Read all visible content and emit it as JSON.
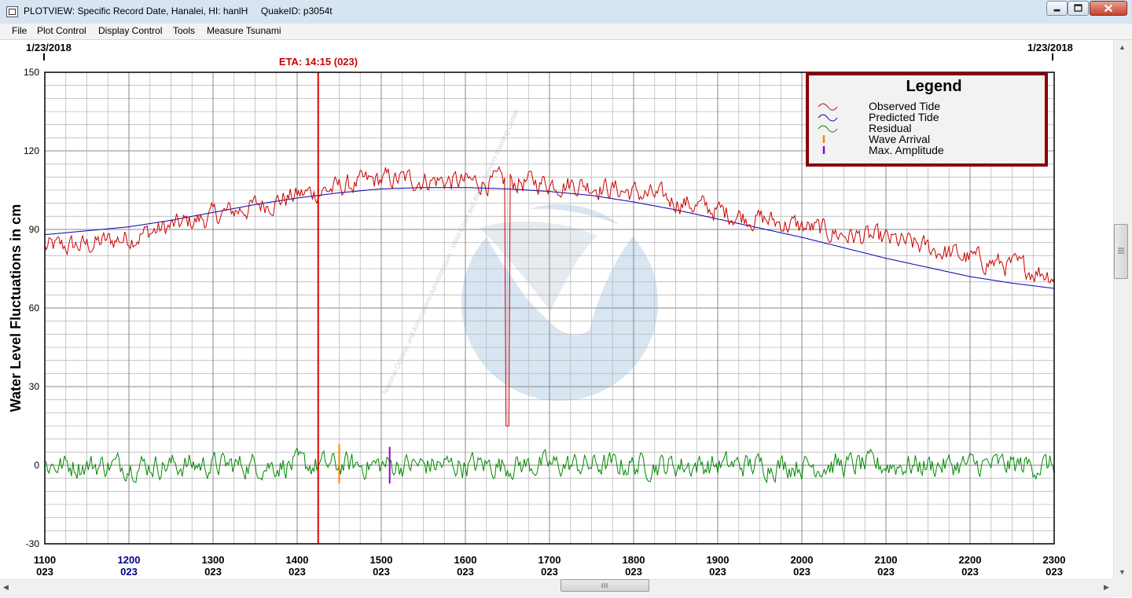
{
  "window": {
    "title": "PLOTVIEW: Specific Record Date, Hanalei, HI: hanlH     QuakeID: p3054t",
    "app_icon": "window-app-icon",
    "controls": [
      "minimize-icon",
      "maximize-icon",
      "close-icon"
    ]
  },
  "menu": {
    "items": [
      "File",
      "Plot Control",
      "Display Control",
      "Tools",
      "Measure Tsunami"
    ]
  },
  "plot": {
    "date_left": "1/23/2018",
    "date_right": "1/23/2018",
    "eta_label": "ETA: 14:15 (023)",
    "y_axis_label": "Water Level Fluctuations in cm",
    "watermark": "National Oceanic and Atmospheric Administration · West Coast and Alaska Tsunami Warning Center",
    "legend": {
      "title": "Legend",
      "entries": [
        {
          "label": "Observed Tide",
          "color": "#cc0000"
        },
        {
          "label": "Predicted Tide",
          "color": "#0000aa"
        },
        {
          "label": "Residual",
          "color": "#008800"
        },
        {
          "label": "Wave Arrival",
          "color": "#ff8000"
        },
        {
          "label": "Max. Amplitude",
          "color": "#9900cc"
        }
      ]
    }
  },
  "chart_data": {
    "type": "line",
    "x_ticks": [
      {
        "time": "1100",
        "day": "023"
      },
      {
        "time": "1200",
        "day": "023",
        "highlight": true
      },
      {
        "time": "1300",
        "day": "023"
      },
      {
        "time": "1400",
        "day": "023"
      },
      {
        "time": "1500",
        "day": "023"
      },
      {
        "time": "1600",
        "day": "023"
      },
      {
        "time": "1700",
        "day": "023"
      },
      {
        "time": "1800",
        "day": "023"
      },
      {
        "time": "1900",
        "day": "023"
      },
      {
        "time": "2000",
        "day": "023"
      },
      {
        "time": "2100",
        "day": "023"
      },
      {
        "time": "2200",
        "day": "023"
      },
      {
        "time": "2300",
        "day": "023"
      }
    ],
    "xlim_hours": [
      11,
      23
    ],
    "y_ticks": [
      150,
      120,
      90,
      60,
      30,
      0,
      -30
    ],
    "ylim": [
      -30,
      150
    ],
    "ylabel": "Water Level Fluctuations in cm",
    "grid": true,
    "legend_position": "top-right",
    "eta_hour": 14.25,
    "spike": {
      "hour": 16.5,
      "min": 15
    },
    "wave_arrival": {
      "hour": 14.5,
      "low": -7,
      "high": 8
    },
    "max_amplitude": {
      "hour": 15.1,
      "low": -7,
      "high": 7
    },
    "series": [
      {
        "name": "Observed Tide",
        "color": "#cc0000",
        "hours": [
          11,
          11.5,
          12,
          12.5,
          13,
          13.5,
          14,
          14.5,
          15,
          15.5,
          16,
          16.5,
          17,
          17.5,
          18,
          18.5,
          19,
          19.5,
          20,
          20.5,
          21,
          21.5,
          22,
          22.5,
          23
        ],
        "values": [
          83,
          84,
          87,
          91,
          95,
          99,
          103,
          106,
          109,
          109,
          108,
          108,
          108,
          107,
          104,
          101,
          97,
          94,
          91,
          88,
          86,
          83,
          79,
          76,
          73
        ]
      },
      {
        "name": "Predicted Tide",
        "color": "#0000aa",
        "hours": [
          11,
          11.5,
          12,
          12.5,
          13,
          13.5,
          14,
          14.5,
          15,
          15.5,
          16,
          16.5,
          17,
          17.5,
          18,
          18.5,
          19,
          19.5,
          20,
          20.5,
          21,
          21.5,
          22,
          22.5,
          23
        ],
        "values": [
          88,
          89.5,
          91,
          93.5,
          96.5,
          99.5,
          102,
          104,
          105.5,
          106,
          106,
          105.5,
          104.5,
          103,
          100.5,
          97.5,
          94,
          90.5,
          87,
          83,
          79,
          75.5,
          72,
          69.5,
          67.5
        ]
      },
      {
        "name": "Residual",
        "color": "#008800",
        "hours": [
          11,
          23
        ],
        "values": [
          0,
          0
        ]
      }
    ]
  }
}
